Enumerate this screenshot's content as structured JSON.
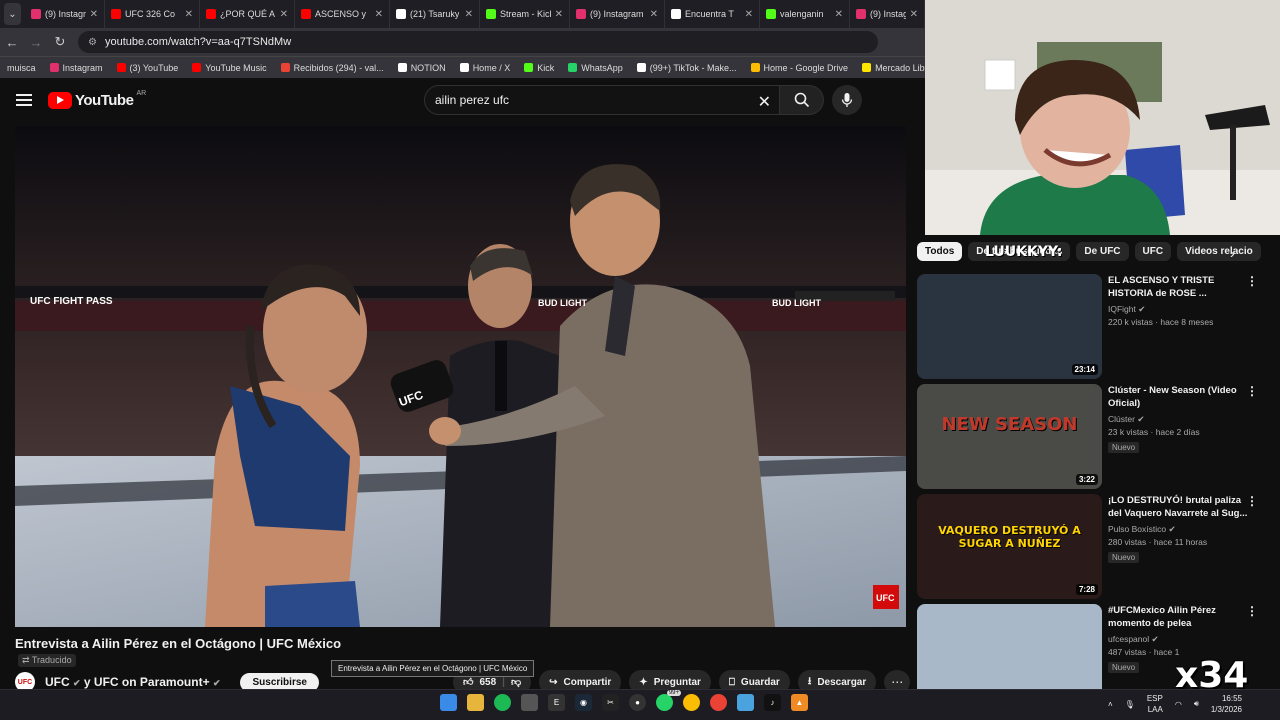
{
  "browser": {
    "tabs": [
      {
        "title": "(9) Instagram",
        "color": "#e1306c"
      },
      {
        "title": "UFC 326 Co",
        "color": "#ff0000"
      },
      {
        "title": "¿POR QUÉ A",
        "color": "#ff0000"
      },
      {
        "title": "ASCENSO y",
        "color": "#ff0000"
      },
      {
        "title": "(21) Tsaruky",
        "color": "#ffffff"
      },
      {
        "title": "Stream - Kick",
        "color": "#53fc18"
      },
      {
        "title": "(9) Instagram",
        "color": "#e1306c"
      },
      {
        "title": "Encuentra T",
        "color": "#ffffff"
      },
      {
        "title": "valenganin",
        "color": "#53fc18"
      },
      {
        "title": "(9) Instagram",
        "color": "#e1306c"
      }
    ],
    "tab_close": "✕",
    "url": "youtube.com/watch?v=aa-q7TSNdMw",
    "bookmarks": [
      {
        "label": "muisca",
        "color": ""
      },
      {
        "label": "Instagram",
        "color": "#e1306c"
      },
      {
        "label": "(3) YouTube",
        "color": "#ff0000"
      },
      {
        "label": "YouTube Music",
        "color": "#ff0000"
      },
      {
        "label": "Recibidos (294) - val...",
        "color": "#ea4335"
      },
      {
        "label": "NOTION",
        "color": "#ffffff"
      },
      {
        "label": "Home / X",
        "color": "#ffffff"
      },
      {
        "label": "Kick",
        "color": "#53fc18"
      },
      {
        "label": "WhatsApp",
        "color": "#25d366"
      },
      {
        "label": "(99+) TikTok - Make...",
        "color": "#ffffff"
      },
      {
        "label": "Home - Google Drive",
        "color": "#fbbc04"
      },
      {
        "label": "Mercado Libre Arge...",
        "color": "#ffe600"
      }
    ]
  },
  "youtube": {
    "logo": "YouTube",
    "country": "AR",
    "search_value": "ailin perez ufc",
    "video": {
      "title": "Entrevista a Ailin Pérez en el Octágono | UFC México",
      "translated_label": "Traducido",
      "tooltip": "Entrevista a Ailin Pérez en el Octágono | UFC México",
      "overlay_sponsor": "UFC FIGHT PASS",
      "overlay_brand": "BUD LIGHT",
      "mic_text": "UFC",
      "corner_logo": "UFC"
    },
    "channel": {
      "avatar": "UFC",
      "name": "UFC",
      "collab": "y UFC on Paramount+",
      "subscribe_label": "Suscribirse"
    },
    "actions": {
      "likes": "658",
      "share": "Compartir",
      "ask": "Preguntar",
      "save": "Guardar",
      "download": "Descargar"
    },
    "filters": [
      "Todos",
      "De tus búsquedas",
      "De UFC",
      "UFC",
      "Videos relacio"
    ],
    "recommendations": [
      {
        "title": "EL ASCENSO Y TRISTE HISTORIA de ROSE ...",
        "channel": "IQFight",
        "views": "220 k vistas · hace 8 meses",
        "duration": "23:14",
        "badge": ""
      },
      {
        "title": "Clúster - New Season (Video Oficial)",
        "channel": "Clúster",
        "views": "23 k vistas · hace 2 días",
        "duration": "3:22",
        "badge": "Nuevo",
        "thumb_text": "NEW SEASON"
      },
      {
        "title": "¡LO DESTRUYÓ! brutal paliza del Vaquero Navarrete al Sug...",
        "channel": "Pulso Boxístico",
        "views": "280 vistas · hace 11 horas",
        "duration": "7:28",
        "badge": "Nuevo",
        "thumb_text": "VAQUERO DESTRUYÓ A SUGAR A NUÑEZ"
      },
      {
        "title": "#UFCMexico Ailin Pérez momento de pelea",
        "channel": "ufcespanol",
        "views": "487 vistas · hace 1",
        "duration": "",
        "badge": "Nuevo"
      }
    ]
  },
  "stream_overlay": {
    "name_text": "LUUKKYY:",
    "multiplier": "x34"
  },
  "taskbar": {
    "lang_top": "ESP",
    "lang_bottom": "LAA",
    "time": "16:55",
    "date": "1/3/2026",
    "badge": "99+"
  }
}
